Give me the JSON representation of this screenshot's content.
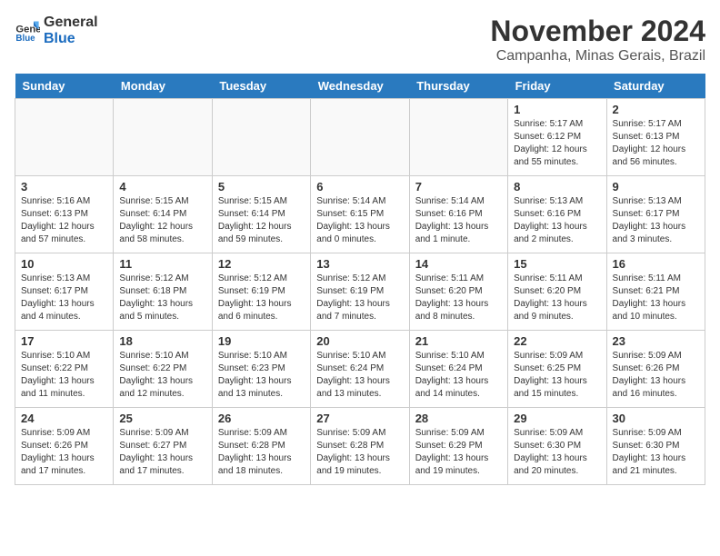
{
  "logo": {
    "text_general": "General",
    "text_blue": "Blue"
  },
  "title": "November 2024",
  "subtitle": "Campanha, Minas Gerais, Brazil",
  "weekdays": [
    "Sunday",
    "Monday",
    "Tuesday",
    "Wednesday",
    "Thursday",
    "Friday",
    "Saturday"
  ],
  "weeks": [
    [
      {
        "day": "",
        "info": ""
      },
      {
        "day": "",
        "info": ""
      },
      {
        "day": "",
        "info": ""
      },
      {
        "day": "",
        "info": ""
      },
      {
        "day": "",
        "info": ""
      },
      {
        "day": "1",
        "info": "Sunrise: 5:17 AM\nSunset: 6:12 PM\nDaylight: 12 hours and 55 minutes."
      },
      {
        "day": "2",
        "info": "Sunrise: 5:17 AM\nSunset: 6:13 PM\nDaylight: 12 hours and 56 minutes."
      }
    ],
    [
      {
        "day": "3",
        "info": "Sunrise: 5:16 AM\nSunset: 6:13 PM\nDaylight: 12 hours and 57 minutes."
      },
      {
        "day": "4",
        "info": "Sunrise: 5:15 AM\nSunset: 6:14 PM\nDaylight: 12 hours and 58 minutes."
      },
      {
        "day": "5",
        "info": "Sunrise: 5:15 AM\nSunset: 6:14 PM\nDaylight: 12 hours and 59 minutes."
      },
      {
        "day": "6",
        "info": "Sunrise: 5:14 AM\nSunset: 6:15 PM\nDaylight: 13 hours and 0 minutes."
      },
      {
        "day": "7",
        "info": "Sunrise: 5:14 AM\nSunset: 6:16 PM\nDaylight: 13 hours and 1 minute."
      },
      {
        "day": "8",
        "info": "Sunrise: 5:13 AM\nSunset: 6:16 PM\nDaylight: 13 hours and 2 minutes."
      },
      {
        "day": "9",
        "info": "Sunrise: 5:13 AM\nSunset: 6:17 PM\nDaylight: 13 hours and 3 minutes."
      }
    ],
    [
      {
        "day": "10",
        "info": "Sunrise: 5:13 AM\nSunset: 6:17 PM\nDaylight: 13 hours and 4 minutes."
      },
      {
        "day": "11",
        "info": "Sunrise: 5:12 AM\nSunset: 6:18 PM\nDaylight: 13 hours and 5 minutes."
      },
      {
        "day": "12",
        "info": "Sunrise: 5:12 AM\nSunset: 6:19 PM\nDaylight: 13 hours and 6 minutes."
      },
      {
        "day": "13",
        "info": "Sunrise: 5:12 AM\nSunset: 6:19 PM\nDaylight: 13 hours and 7 minutes."
      },
      {
        "day": "14",
        "info": "Sunrise: 5:11 AM\nSunset: 6:20 PM\nDaylight: 13 hours and 8 minutes."
      },
      {
        "day": "15",
        "info": "Sunrise: 5:11 AM\nSunset: 6:20 PM\nDaylight: 13 hours and 9 minutes."
      },
      {
        "day": "16",
        "info": "Sunrise: 5:11 AM\nSunset: 6:21 PM\nDaylight: 13 hours and 10 minutes."
      }
    ],
    [
      {
        "day": "17",
        "info": "Sunrise: 5:10 AM\nSunset: 6:22 PM\nDaylight: 13 hours and 11 minutes."
      },
      {
        "day": "18",
        "info": "Sunrise: 5:10 AM\nSunset: 6:22 PM\nDaylight: 13 hours and 12 minutes."
      },
      {
        "day": "19",
        "info": "Sunrise: 5:10 AM\nSunset: 6:23 PM\nDaylight: 13 hours and 13 minutes."
      },
      {
        "day": "20",
        "info": "Sunrise: 5:10 AM\nSunset: 6:24 PM\nDaylight: 13 hours and 13 minutes."
      },
      {
        "day": "21",
        "info": "Sunrise: 5:10 AM\nSunset: 6:24 PM\nDaylight: 13 hours and 14 minutes."
      },
      {
        "day": "22",
        "info": "Sunrise: 5:09 AM\nSunset: 6:25 PM\nDaylight: 13 hours and 15 minutes."
      },
      {
        "day": "23",
        "info": "Sunrise: 5:09 AM\nSunset: 6:26 PM\nDaylight: 13 hours and 16 minutes."
      }
    ],
    [
      {
        "day": "24",
        "info": "Sunrise: 5:09 AM\nSunset: 6:26 PM\nDaylight: 13 hours and 17 minutes."
      },
      {
        "day": "25",
        "info": "Sunrise: 5:09 AM\nSunset: 6:27 PM\nDaylight: 13 hours and 17 minutes."
      },
      {
        "day": "26",
        "info": "Sunrise: 5:09 AM\nSunset: 6:28 PM\nDaylight: 13 hours and 18 minutes."
      },
      {
        "day": "27",
        "info": "Sunrise: 5:09 AM\nSunset: 6:28 PM\nDaylight: 13 hours and 19 minutes."
      },
      {
        "day": "28",
        "info": "Sunrise: 5:09 AM\nSunset: 6:29 PM\nDaylight: 13 hours and 19 minutes."
      },
      {
        "day": "29",
        "info": "Sunrise: 5:09 AM\nSunset: 6:30 PM\nDaylight: 13 hours and 20 minutes."
      },
      {
        "day": "30",
        "info": "Sunrise: 5:09 AM\nSunset: 6:30 PM\nDaylight: 13 hours and 21 minutes."
      }
    ]
  ]
}
